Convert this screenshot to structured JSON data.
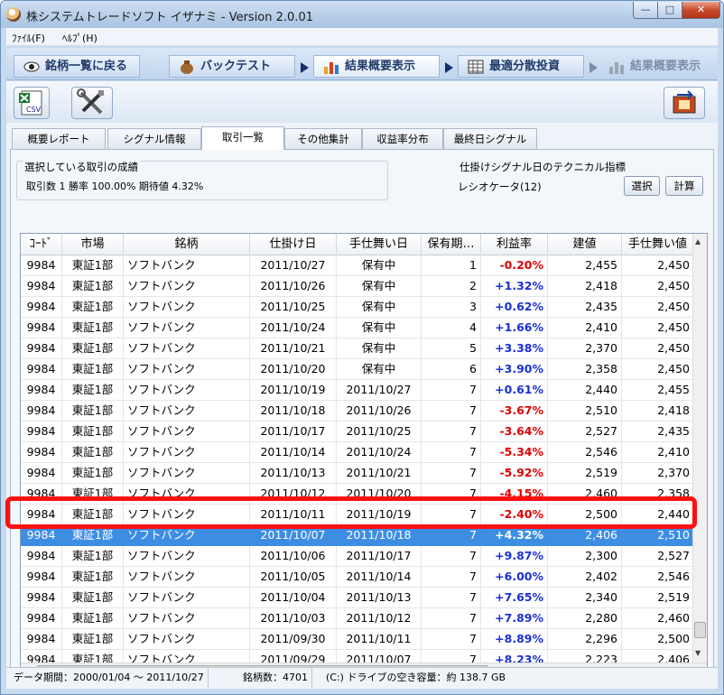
{
  "window": {
    "title": "株システムトレードソフト イザナミ - Version 2.0.01",
    "min_glyph": "—",
    "max_glyph": "□",
    "close_glyph": "✕"
  },
  "menu": [
    {
      "label": "ﾌｧｲﾙ(F)"
    },
    {
      "label": "ﾍﾙﾌﾟ(H)"
    }
  ],
  "nav": {
    "back_label": "銘柄一覧に戻る",
    "backtest_label": "バックテスト",
    "summary_label": "結果概要表示",
    "optimize_label": "最適分散投資",
    "summary2_label": "結果概要表示"
  },
  "subtabs": [
    {
      "label": "概要レポート"
    },
    {
      "label": "シグナル情報"
    },
    {
      "label": "取引一覧"
    },
    {
      "label": "その他集計"
    },
    {
      "label": "収益率分布"
    },
    {
      "label": "最終日シグナル"
    }
  ],
  "results": {
    "title": "選択している取引の成績",
    "text": "取引数 1  勝率 100.00%  期待値 4.32%"
  },
  "indicator": {
    "title": "仕掛けシグナル日のテクニカル指標",
    "value": "レシオケータ(12)",
    "select_label": "選択",
    "calc_label": "計算"
  },
  "columns": [
    "ｺｰﾄﾞ",
    "市場",
    "銘柄",
    "仕掛け日",
    "手仕舞い日",
    "保有期…",
    "利益率",
    "建値",
    "手仕舞い値"
  ],
  "rows": [
    {
      "code": "9984",
      "market": "東証1部",
      "name": "ソフトバンク",
      "entry": "2011/10/27",
      "exit": "保有中",
      "days": "1",
      "profit": "-0.20%",
      "price": "2,455",
      "exitprice": "2,450"
    },
    {
      "code": "9984",
      "market": "東証1部",
      "name": "ソフトバンク",
      "entry": "2011/10/26",
      "exit": "保有中",
      "days": "2",
      "profit": "+1.32%",
      "price": "2,418",
      "exitprice": "2,450"
    },
    {
      "code": "9984",
      "market": "東証1部",
      "name": "ソフトバンク",
      "entry": "2011/10/25",
      "exit": "保有中",
      "days": "3",
      "profit": "+0.62%",
      "price": "2,435",
      "exitprice": "2,450"
    },
    {
      "code": "9984",
      "market": "東証1部",
      "name": "ソフトバンク",
      "entry": "2011/10/24",
      "exit": "保有中",
      "days": "4",
      "profit": "+1.66%",
      "price": "2,410",
      "exitprice": "2,450"
    },
    {
      "code": "9984",
      "market": "東証1部",
      "name": "ソフトバンク",
      "entry": "2011/10/21",
      "exit": "保有中",
      "days": "5",
      "profit": "+3.38%",
      "price": "2,370",
      "exitprice": "2,450"
    },
    {
      "code": "9984",
      "market": "東証1部",
      "name": "ソフトバンク",
      "entry": "2011/10/20",
      "exit": "保有中",
      "days": "6",
      "profit": "+3.90%",
      "price": "2,358",
      "exitprice": "2,450"
    },
    {
      "code": "9984",
      "market": "東証1部",
      "name": "ソフトバンク",
      "entry": "2011/10/19",
      "exit": "2011/10/27",
      "days": "7",
      "profit": "+0.61%",
      "price": "2,440",
      "exitprice": "2,455"
    },
    {
      "code": "9984",
      "market": "東証1部",
      "name": "ソフトバンク",
      "entry": "2011/10/18",
      "exit": "2011/10/26",
      "days": "7",
      "profit": "-3.67%",
      "price": "2,510",
      "exitprice": "2,418"
    },
    {
      "code": "9984",
      "market": "東証1部",
      "name": "ソフトバンク",
      "entry": "2011/10/17",
      "exit": "2011/10/25",
      "days": "7",
      "profit": "-3.64%",
      "price": "2,527",
      "exitprice": "2,435"
    },
    {
      "code": "9984",
      "market": "東証1部",
      "name": "ソフトバンク",
      "entry": "2011/10/14",
      "exit": "2011/10/24",
      "days": "7",
      "profit": "-5.34%",
      "price": "2,546",
      "exitprice": "2,410"
    },
    {
      "code": "9984",
      "market": "東証1部",
      "name": "ソフトバンク",
      "entry": "2011/10/13",
      "exit": "2011/10/21",
      "days": "7",
      "profit": "-5.92%",
      "price": "2,519",
      "exitprice": "2,370"
    },
    {
      "code": "9984",
      "market": "東証1部",
      "name": "ソフトバンク",
      "entry": "2011/10/12",
      "exit": "2011/10/20",
      "days": "7",
      "profit": "-4.15%",
      "price": "2,460",
      "exitprice": "2,358"
    },
    {
      "code": "9984",
      "market": "東証1部",
      "name": "ソフトバンク",
      "entry": "2011/10/11",
      "exit": "2011/10/19",
      "days": "7",
      "profit": "-2.40%",
      "price": "2,500",
      "exitprice": "2,440"
    },
    {
      "code": "9984",
      "market": "東証1部",
      "name": "ソフトバンク",
      "entry": "2011/10/07",
      "exit": "2011/10/18",
      "days": "7",
      "profit": "+4.32%",
      "price": "2,406",
      "exitprice": "2,510",
      "selected": true
    },
    {
      "code": "9984",
      "market": "東証1部",
      "name": "ソフトバンク",
      "entry": "2011/10/06",
      "exit": "2011/10/17",
      "days": "7",
      "profit": "+9.87%",
      "price": "2,300",
      "exitprice": "2,527"
    },
    {
      "code": "9984",
      "market": "東証1部",
      "name": "ソフトバンク",
      "entry": "2011/10/05",
      "exit": "2011/10/14",
      "days": "7",
      "profit": "+6.00%",
      "price": "2,402",
      "exitprice": "2,546"
    },
    {
      "code": "9984",
      "market": "東証1部",
      "name": "ソフトバンク",
      "entry": "2011/10/04",
      "exit": "2011/10/13",
      "days": "7",
      "profit": "+7.65%",
      "price": "2,340",
      "exitprice": "2,519"
    },
    {
      "code": "9984",
      "market": "東証1部",
      "name": "ソフトバンク",
      "entry": "2011/10/03",
      "exit": "2011/10/12",
      "days": "7",
      "profit": "+7.89%",
      "price": "2,280",
      "exitprice": "2,460"
    },
    {
      "code": "9984",
      "market": "東証1部",
      "name": "ソフトバンク",
      "entry": "2011/09/30",
      "exit": "2011/10/11",
      "days": "7",
      "profit": "+8.89%",
      "price": "2,296",
      "exitprice": "2,500"
    },
    {
      "code": "9984",
      "market": "東証1部",
      "name": "ソフトバンク",
      "entry": "2011/09/29",
      "exit": "2011/10/07",
      "days": "7",
      "profit": "+8.23%",
      "price": "2,223",
      "exitprice": "2,406"
    }
  ],
  "status": {
    "period": "データ期間：2000/01/04 〜 2011/10/27",
    "stocks": "銘柄数：4701",
    "disk": "(C:) ドライブの空き容量：約 138.7 GB"
  },
  "colors": {
    "positive": "#1a2fd6",
    "negative": "#e00000",
    "selection": "#3d8ee3",
    "highlight": "#ff1010"
  }
}
